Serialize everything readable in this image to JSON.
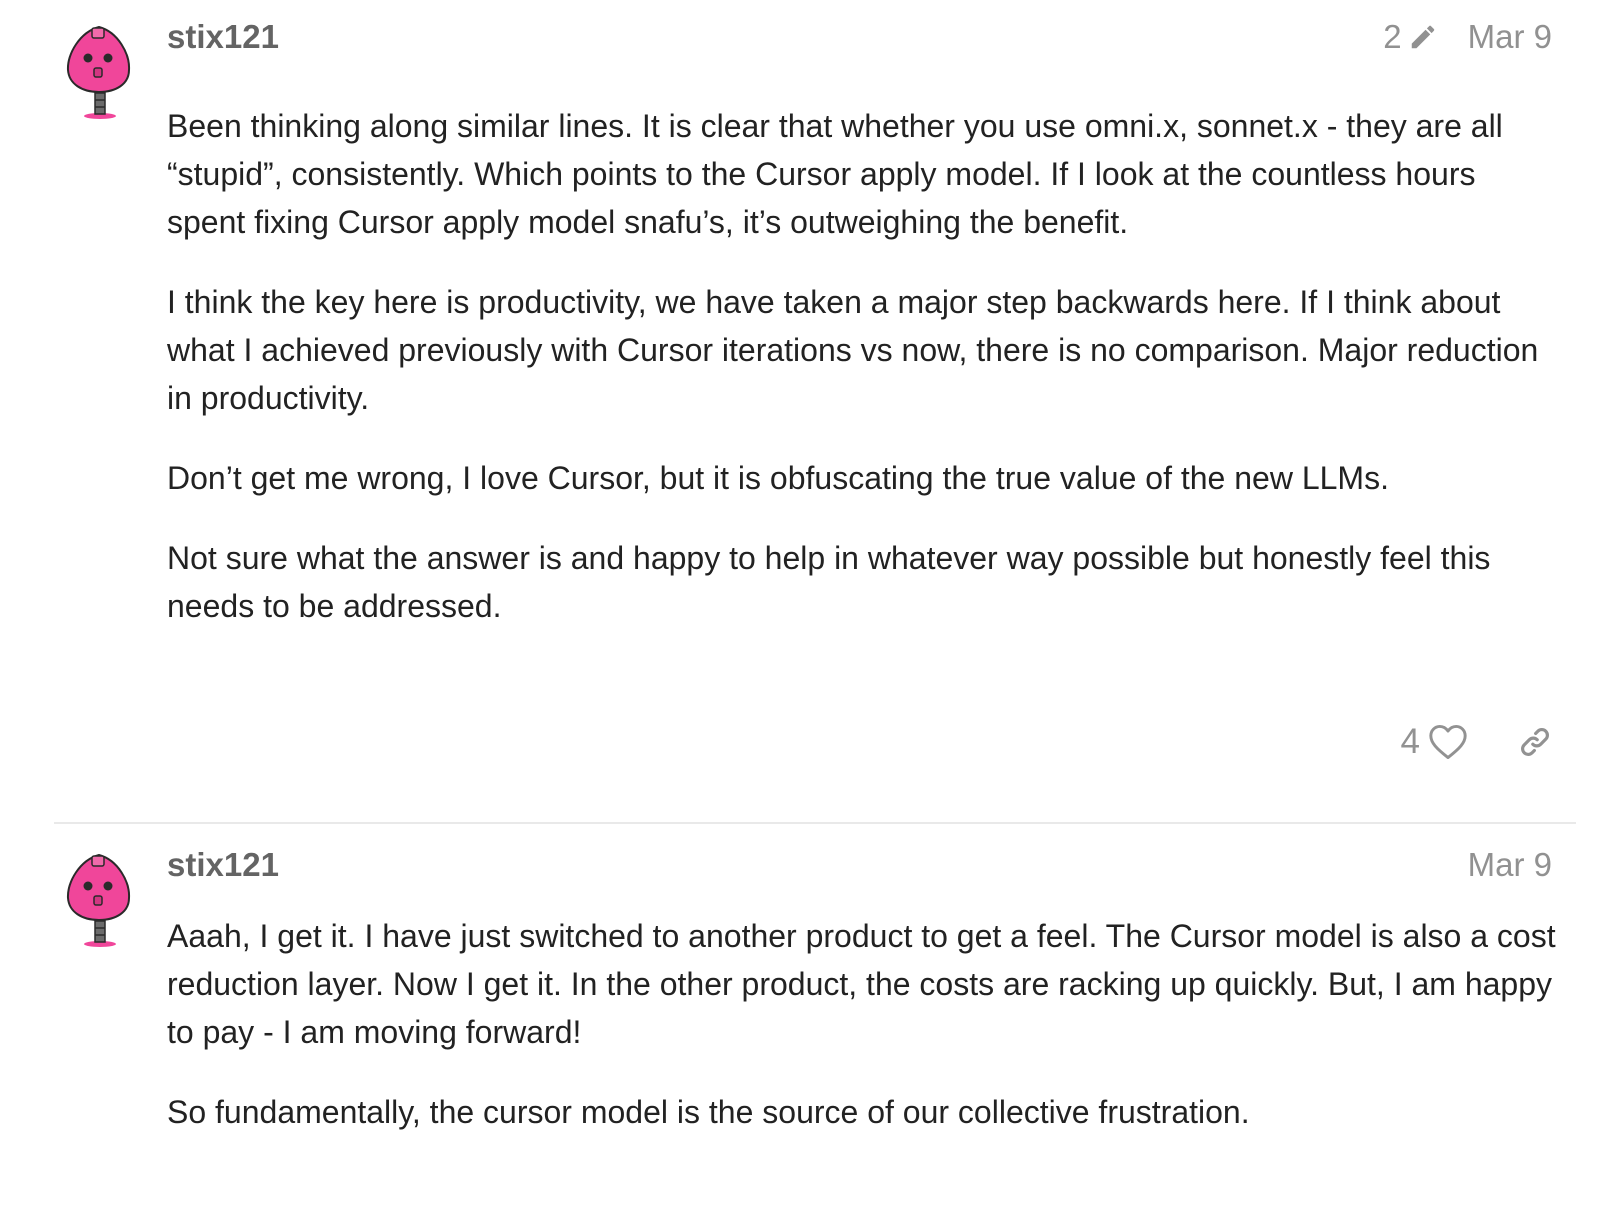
{
  "posts": [
    {
      "username": "stix121",
      "edit_count": "2",
      "date": "Mar 9",
      "paragraphs": [
        "Been thinking along similar lines. It is clear that whether you use omni.x, sonnet.x - they are all “stupid”, consistently. Which points to the Cursor apply model. If I look at the countless hours spent fixing Cursor apply model snafu’s, it’s outweighing the benefit.",
        "I think the key here is productivity, we have taken a major step backwards here. If I think about what I achieved previously with Cursor iterations vs now, there is no comparison. Major reduction in productivity.",
        "Don’t get me wrong, I love Cursor, but it is obfuscating the true value of the new LLMs.",
        "Not sure what the answer is and happy to help in whatever way possible but honestly feel this needs to be addressed."
      ],
      "like_count": "4"
    },
    {
      "username": "stix121",
      "date": "Mar 9",
      "paragraphs": [
        "Aaah, I get it. I have just switched to another product to get a feel. The Cursor model is also a cost reduction layer. Now I get it. In the other product, the costs are racking up quickly. But, I am happy to pay - I am moving forward!",
        "So fundamentally, the cursor model is the source of our collective frustration."
      ]
    }
  ],
  "icons": {
    "edit": "pencil-icon",
    "like": "heart-icon",
    "share": "link-icon",
    "avatar": "pink-robot-avatar"
  },
  "colors": {
    "avatar_pink": "#f0469a",
    "username": "#646464",
    "meta": "#919191",
    "body_text": "#222222",
    "divider": "#e9e9e9"
  }
}
